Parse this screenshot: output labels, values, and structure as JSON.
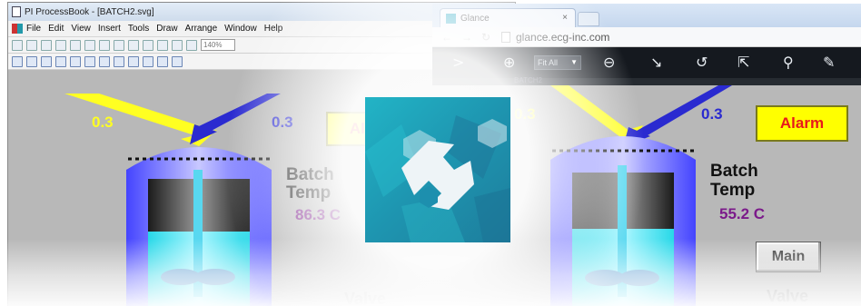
{
  "processbook": {
    "title": "PI ProcessBook - [BATCH2.svg]",
    "menu": [
      "File",
      "Edit",
      "View",
      "Insert",
      "Tools",
      "Draw",
      "Arrange",
      "Window",
      "Help"
    ],
    "zoom": "140%",
    "flow_left": "0.3",
    "flow_right": "0.3",
    "alarm": "Alarm",
    "batch_label_1": "Batch",
    "batch_label_2": "Temp",
    "temp": "86.3 C",
    "valve": "Valve"
  },
  "browser": {
    "tab_title": "Glance",
    "tab_close": "×",
    "url": "glance.ecg-inc.com",
    "fit_label": "Fit All",
    "subtitle": "BATCH2",
    "flow_left": "0.3",
    "flow_right": "0.3",
    "alarm": "Alarm",
    "batch_label_1": "Batch",
    "batch_label_2": "Temp",
    "temp": "55.2 C",
    "main_button": "Main",
    "valve": "Valve"
  },
  "colors": {
    "gray_bg": "#b8b8b8",
    "tank_blue": "#5a5cff",
    "liquid": "#33e8f0",
    "alarm_yellow": "#ffff00",
    "alarm_text": "#e8191b",
    "temp_text": "#7b1a8a",
    "flow_yellow": "#ffff22",
    "flow_blue": "#2a2ad0",
    "logo_teal": "#1e95b0"
  },
  "icons": [
    "processbook-app-icon",
    "browser-favicon",
    "wrench-logo-icon",
    "zoom-in-icon",
    "zoom-out-icon",
    "trend-icon",
    "history-icon",
    "export-icon",
    "search-icon",
    "annotate-icon"
  ]
}
